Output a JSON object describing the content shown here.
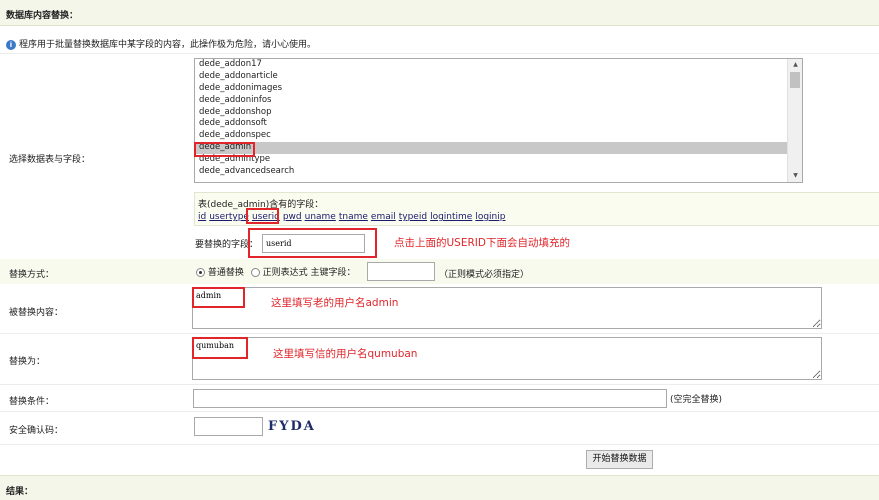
{
  "header": {
    "title": "数据库内容替换："
  },
  "notice": {
    "icon": "info-icon",
    "text": "程序用于批量替换数据库中某字段的内容，此操作极为危险，请小心使用。"
  },
  "table_select": {
    "label": "选择数据表与字段：",
    "options": [
      "dede_addon17",
      "dede_addonarticle",
      "dede_addonimages",
      "dede_addoninfos",
      "dede_addonshop",
      "dede_addonsoft",
      "dede_addonspec",
      "dede_admin",
      "dede_admintype",
      "dede_advancedsearch"
    ],
    "selected": "dede_admin"
  },
  "fields": {
    "title": "表(dede_admin)含有的字段：",
    "list": [
      "id",
      "usertype",
      "userid",
      "pwd",
      "uname",
      "tname",
      "email",
      "typeid",
      "logintime",
      "loginip"
    ],
    "target_label": "要替换的字段：",
    "target_value": "userid",
    "annotation": "点击上面的USERID下面会自动填充的"
  },
  "replace_mode": {
    "label": "替换方式：",
    "normal": "普通替换",
    "regex": "正则表达式",
    "primary_key_label": "主键字段：",
    "primary_key_value": "",
    "note": "（正则模式必须指定）"
  },
  "old_content": {
    "label": "被替换内容：",
    "value": "admin",
    "annotation": "这里填写老的用户名admin"
  },
  "new_content": {
    "label": "替换为：",
    "value": "qumuban",
    "annotation": "这里填写信的用户名qumuban"
  },
  "condition": {
    "label": "替换条件：",
    "value": "",
    "note": "(空完全替换)"
  },
  "captcha": {
    "label": "安全确认码：",
    "value": "",
    "image_text": "FYDA"
  },
  "submit": {
    "label": "开始替换数据"
  },
  "result": {
    "label": "结果："
  },
  "colors": {
    "annotation_red": "#e0262b",
    "header_bg": "#f4f6ea",
    "row_yellow": "#f9faee",
    "link_blue": "#1a1a6e"
  }
}
